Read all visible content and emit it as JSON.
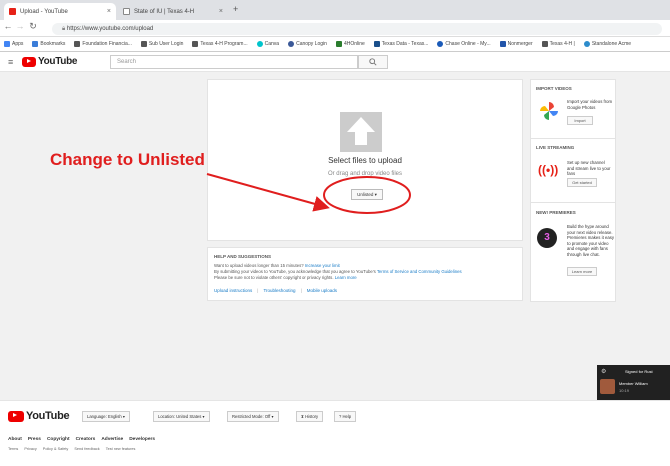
{
  "browser": {
    "tabs": [
      {
        "title": "Upload - YouTube",
        "favicon_color": "#e62117"
      },
      {
        "title": "State of IU | Texas 4-H",
        "favicon_color": "#888888"
      }
    ],
    "new_tab": "+",
    "url": "https://www.youtube.com/upload",
    "bookmarks": [
      {
        "label": "Apps",
        "color": "#4285f4"
      },
      {
        "label": "Bookmarks",
        "color": "#3b7dd8"
      },
      {
        "label": "Foundation Financia...",
        "color": "#555555"
      },
      {
        "label": "Sub User Login",
        "color": "#555555"
      },
      {
        "label": "Texas 4-H Program...",
        "color": "#555555"
      },
      {
        "label": "Canva",
        "color": "#00c4cc"
      },
      {
        "label": "Canopy Login",
        "color": "#3b5998"
      },
      {
        "label": "4HOnline",
        "color": "#2a7d2e"
      },
      {
        "label": "Texas Data - Texas...",
        "color": "#1a4f8b"
      },
      {
        "label": "Chase Online - My...",
        "color": "#1a5ab8"
      },
      {
        "label": "Nonmerger",
        "color": "#2255aa"
      },
      {
        "label": "Texas 4-H |",
        "color": "#555555"
      },
      {
        "label": "Standalone Acme",
        "color": "#2d8ccc"
      }
    ]
  },
  "youtube": {
    "logo_text": "YouTube",
    "search_placeholder": "Search",
    "search_icon": "search-icon"
  },
  "upload": {
    "title": "Select files to upload",
    "subtitle": "Or drag and drop video files",
    "privacy_selected": "Unlisted"
  },
  "annotation": {
    "label": "Change to Unlisted",
    "color": "#e01e1e"
  },
  "help": {
    "heading": "HELP AND SUGGESTIONS",
    "line1_prefix": "Want to upload videos longer than 15 minutes? ",
    "line1_link": "Increase your limit",
    "line2_prefix": "By submitting your videos to YouTube, you acknowledge that you agree to YouTube's ",
    "line2_link": "Terms of Service and Community Guidelines",
    "line3_prefix": "Please be sure not to violate others' copyright or privacy rights. ",
    "line3_link": "Learn more",
    "links": [
      "Upload instructions",
      "Troubleshooting",
      "Mobile uploads"
    ]
  },
  "sidebar": {
    "import": {
      "heading": "IMPORT VIDEOS",
      "text": "Import your videos from Google Photos",
      "button": "Import"
    },
    "live": {
      "heading": "LIVE STREAMING",
      "text": "Set up new channel and stream live to your fans",
      "button": "Get started"
    },
    "premieres": {
      "heading": "NEW! PREMIERES",
      "text": "Build the hype around your next video release. Premieres makes it easy to promote your video and engage with fans through live chat.",
      "button": "Learn more"
    }
  },
  "toast": {
    "title": "Signed for Rust",
    "name": "Member William",
    "time": "10:19"
  },
  "footer": {
    "logo_text": "YouTube",
    "buttons": [
      "Language: English",
      "Location: United States",
      "Restricted Mode: Off",
      "History",
      "Help"
    ],
    "links": [
      "About",
      "Press",
      "Copyright",
      "Creators",
      "Advertise",
      "Developers"
    ],
    "links2": [
      "Terms",
      "Privacy",
      "Policy & Safety",
      "Send feedback",
      "Test new features"
    ]
  }
}
